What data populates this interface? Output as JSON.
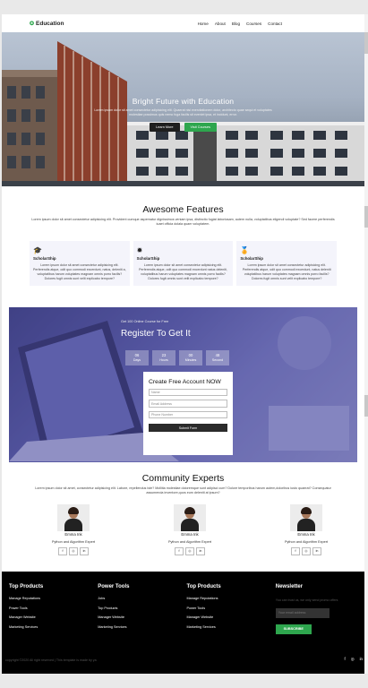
{
  "nav": {
    "logo": "Education",
    "links": [
      "Home",
      "About",
      "Blog",
      "Courses",
      "Contact"
    ]
  },
  "hero": {
    "title": "Bright Future with Education",
    "text": "Lorem ipsum dolor sit amet consectetur adipisicing elit. Quaerat nisi exercitationem dolor, architecto quae sequi et voluptates molestiae possimus quis nemo fuga facilis sit eveniet ipsa, et incidunt, error.",
    "learn_more": "Learn More",
    "visit_courses": "Visit Courses"
  },
  "features": {
    "title": "Awesome Features",
    "subtitle": "Lorem ipsum dolor sit amet consectetur adipisicing elit. Provident cumque aspernatur dignissimos veniam ipsa, distinctio fugiat laboriosam, autem nulla, voluptatibus eligendi voluptate? Sed facere perferendis iuaet officia dolala quam voluptatem.",
    "cards": [
      {
        "icon": "mortarboard-icon",
        "title": "ScholarShip",
        "text": "Lorem ipsum dolor sit amet consectetur adipisicing elit. Perferendis atque, odit quo commodi excerdunt, natus, deleniti a, voluptatibus harum voluptates magnam omnis porro facilis? Dolores fugit omnis sunt velit explicabo tempore?"
      },
      {
        "icon": "badge-icon",
        "title": "ScholarShip",
        "text": "Lorem ipsum dolor sit amet consectetur adipisicing elit. Perferendis atque, odit quo commodi excerdunt natus deleniti, voluptatibus harum voluptates magnam omnis porro facilis? Dolores fugit omnis sunt velit explicabo tempore?"
      },
      {
        "icon": "medal-icon",
        "title": "ScholarShip",
        "text": "Lorem ipsum dolor sit amet consectetur adipisicing elit. Perferendis atque, odit quo commodi excerdunt, natus deleniti voluptatibus harum voluptates magnam omnis porro facilis? Dolores fugit omnis sunt velit explicabo tempore?"
      }
    ]
  },
  "signup": {
    "course": "Get 100 Online Course for Free",
    "title": "Register To Get It",
    "timer": [
      {
        "num": "06",
        "label": "Days"
      },
      {
        "num": "23",
        "label": "Hours"
      },
      {
        "num": "00",
        "label": "Minutes"
      },
      {
        "num": "48",
        "label": "Second"
      }
    ],
    "form_title": "Create Free Account NOW",
    "name_placeholder": "Name",
    "email_placeholder": "Email Address",
    "phone_placeholder": "Phone Number",
    "submit": "Submit Form"
  },
  "experts": {
    "title": "Community Experts",
    "subtitle": "Lorem ipsum dolor sit amet, consectetur adipisicing elit. Labore, repellendus iste? Mollitia molestiae doloremque sunt adipisci cum? Dolore temporibus harum autem,doloribus iusto quaerat? Consequatur assumenda inventore,quos eum deleniti at ipsum?",
    "people": [
      {
        "name": "Emma Ink",
        "role": "Python and Algorithm Expert"
      },
      {
        "name": "Emma Ink",
        "role": "Python and Algorithm Expert"
      },
      {
        "name": "Emma Ink",
        "role": "Python and Algorithm Expert"
      }
    ],
    "social": [
      "f",
      "◎",
      "in"
    ]
  },
  "footer": {
    "columns": [
      {
        "title": "Top Products",
        "items": [
          "Manage Reputations",
          "Power Tools",
          "Manager Website",
          "Marketing Services"
        ]
      },
      {
        "title": "Power Tools",
        "items": [
          "Jobs",
          "Top Products",
          "Manager Website",
          "Marketing Services"
        ]
      },
      {
        "title": "Top Products",
        "items": [
          "Manage Reputations",
          "Power Tools",
          "Manager Website",
          "Marketing Services"
        ]
      }
    ],
    "newsletter_title": "Newsletter",
    "newsletter_text": "You can trust us, we only send promo offers",
    "email_placeholder": "Your email address",
    "subscribe": "SUBSCRIBE",
    "copyright": "copyright ©2020 All right reserved | This template is made by ya",
    "social": [
      "f",
      "◎",
      "in"
    ]
  }
}
